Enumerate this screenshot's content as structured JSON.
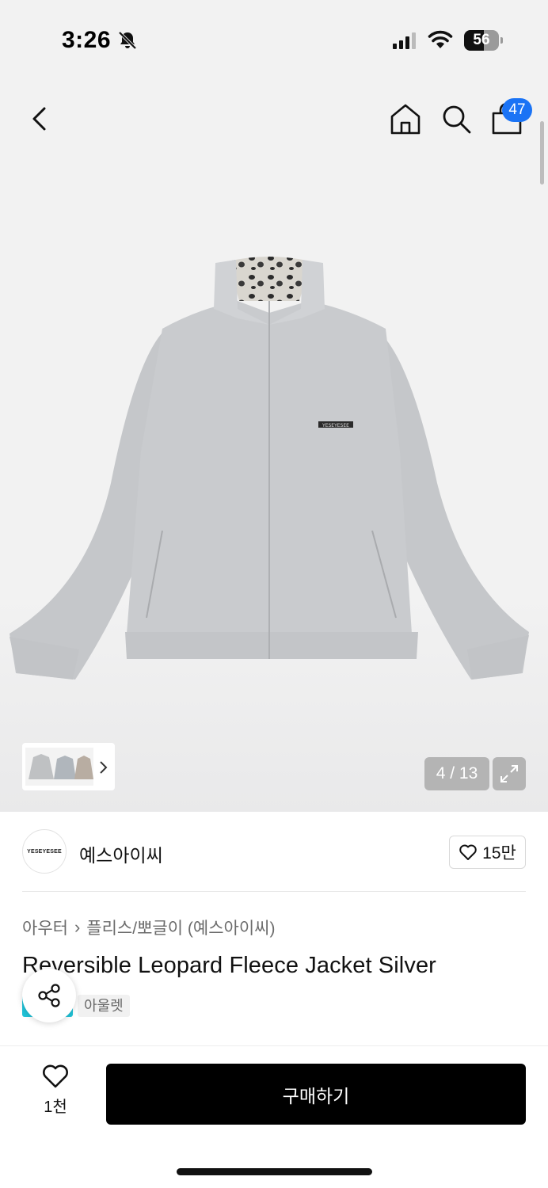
{
  "status_bar": {
    "time": "3:26",
    "battery_level": "56",
    "battery_fraction": 0.56,
    "icons": [
      "bell-off-icon",
      "cellular-signal-icon",
      "wifi-icon",
      "battery-icon"
    ]
  },
  "nav": {
    "icons": [
      "back-chevron-icon",
      "home-icon",
      "search-icon",
      "shopping-bag-icon"
    ],
    "cart_badge": "47"
  },
  "gallery": {
    "counter": "4 / 13",
    "expand_icon": "expand-arrows-icon",
    "thumbnail_more_icon": "chevron-right-icon",
    "jacket_logo_text": "YESEYESEE"
  },
  "brand": {
    "logo_text": "YESEYESEE",
    "name": "예스아이씨",
    "likes": "15만"
  },
  "product": {
    "breadcrumb": [
      "아우터",
      "플리스/뽀글이 (예스아이씨)"
    ],
    "title": "Reversible Leopard Fleece Jacket Silver",
    "tag_label": "아울렛"
  },
  "bottom_bar": {
    "wish_count": "1천",
    "buy_label": "구매하기"
  },
  "colors": {
    "accent_blue": "#1a73f5",
    "buy_button": "#000000",
    "tag_cyan": "#21c3d8",
    "jacket_silver": "#c7c9cc"
  }
}
